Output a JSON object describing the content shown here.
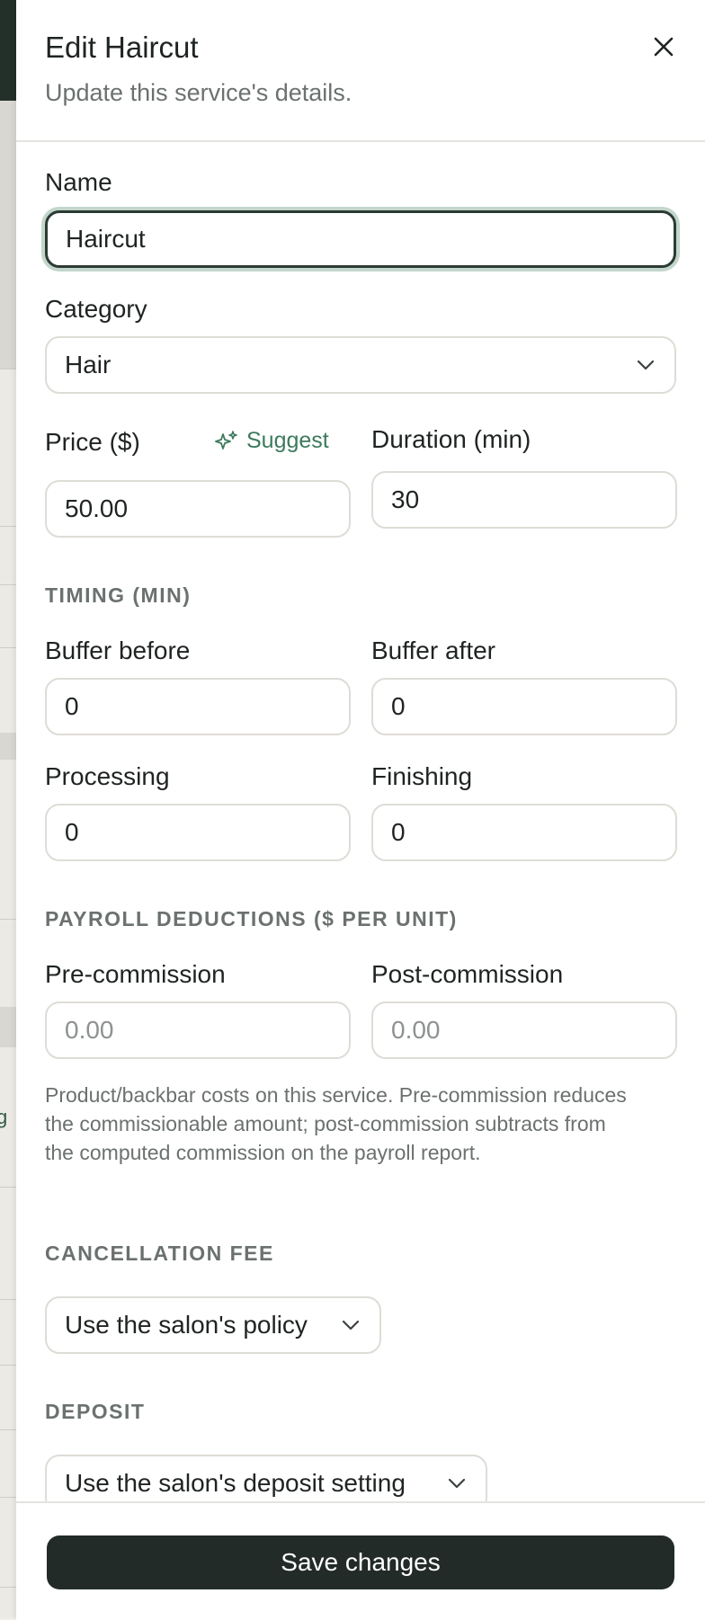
{
  "dialog": {
    "title": "Edit Haircut",
    "subtitle": "Update this service's details."
  },
  "fields": {
    "name": {
      "label": "Name",
      "value": "Haircut"
    },
    "category": {
      "label": "Category",
      "value": "Hair"
    },
    "price": {
      "label": "Price ($)",
      "value": "50.00",
      "suggest_label": "Suggest"
    },
    "duration": {
      "label": "Duration (min)",
      "value": "30"
    }
  },
  "timing": {
    "heading": "TIMING (MIN)",
    "buffer_before": {
      "label": "Buffer before",
      "value": "0"
    },
    "buffer_after": {
      "label": "Buffer after",
      "value": "0"
    },
    "processing": {
      "label": "Processing",
      "value": "0"
    },
    "finishing": {
      "label": "Finishing",
      "value": "0"
    }
  },
  "payroll": {
    "heading": "PAYROLL DEDUCTIONS ($ PER UNIT)",
    "pre_commission": {
      "label": "Pre-commission",
      "placeholder": "0.00"
    },
    "post_commission": {
      "label": "Post-commission",
      "placeholder": "0.00"
    },
    "help": "Product/backbar costs on this service. Pre-commission reduces the commissionable amount; post-commission subtracts from the computed commission on the payroll report."
  },
  "cancellation": {
    "heading": "CANCELLATION FEE",
    "value": "Use the salon's policy"
  },
  "deposit": {
    "heading": "DEPOSIT",
    "value": "Use the salon's deposit setting"
  },
  "footer": {
    "save_label": "Save changes"
  },
  "background": {
    "peek_text": "g"
  },
  "icons": {
    "close": "close-icon",
    "chevron": "chevron-down-icon",
    "sparkle": "sparkle-icon"
  },
  "colors": {
    "primary": "#222b27",
    "accent": "#3d7a5e",
    "focus_ring": "#c3d6cc",
    "muted_text": "#6b716e"
  }
}
